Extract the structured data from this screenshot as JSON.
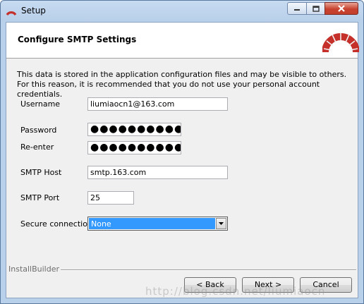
{
  "window": {
    "title": "Setup",
    "icon": "installer-arc-icon",
    "controls": [
      "minimize-icon",
      "maximize-icon",
      "close-icon"
    ]
  },
  "header": {
    "title": "Configure SMTP Settings",
    "logo": "bitnami-arc-logo"
  },
  "description": "This data is stored in the application configuration files and may be visible to others. For this reason, it is recommended that you do not use your personal account credentials.",
  "form": {
    "username": {
      "label": "Username",
      "value": "liumiaocn1@163.com"
    },
    "password": {
      "label": "Password",
      "value": "●●●●●●●●●●●"
    },
    "reenter": {
      "label": "Re-enter",
      "value": "●●●●●●●●●●●"
    },
    "smtp_host": {
      "label": "SMTP Host",
      "value": "smtp.163.com"
    },
    "smtp_port": {
      "label": "SMTP Port",
      "value": "25"
    },
    "secure_connection": {
      "label": "Secure connection",
      "value": "None"
    }
  },
  "footer": {
    "brand": "InstallBuilder",
    "back_label": "< Back",
    "next_label": "Next >",
    "cancel_label": "Cancel"
  },
  "watermark": "http://blog.csdn.net/liumiaocn",
  "colors": {
    "logo_red": "#c5302a",
    "selection_blue": "#3399ff",
    "close_red": "#c8432f"
  }
}
